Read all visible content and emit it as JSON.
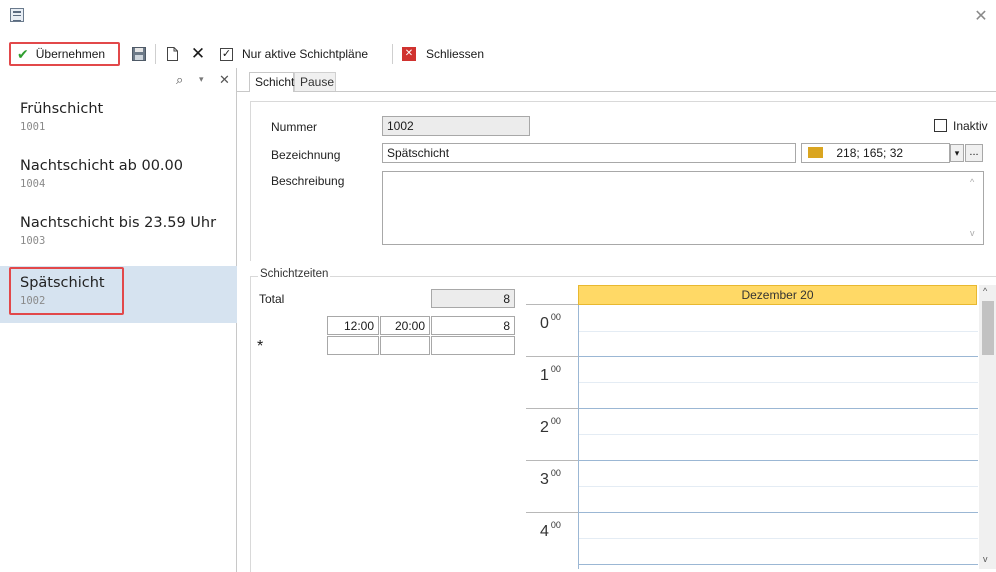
{
  "toolbar": {
    "apply_label": "Übernehmen",
    "active_plans_label": "Nur aktive Schichtpläne",
    "close_label": "Schliessen"
  },
  "list": {
    "items": [
      {
        "name": "Frühschicht",
        "code": "1001",
        "selected": false
      },
      {
        "name": "Nachtschicht ab 00.00",
        "code": "1004",
        "selected": false
      },
      {
        "name": "Nachtschicht bis 23.59 Uhr",
        "code": "1003",
        "selected": false
      },
      {
        "name": "Spätschicht",
        "code": "1002",
        "selected": true
      }
    ]
  },
  "tabs": [
    {
      "label": "Schicht",
      "active": true
    },
    {
      "label": "Pause",
      "active": false
    }
  ],
  "form": {
    "nummer_label": "Nummer",
    "nummer_value": "1002",
    "bezeichnung_label": "Bezeichnung",
    "bezeichnung_value": "Spätschicht",
    "beschreibung_label": "Beschreibung",
    "beschreibung_value": "",
    "inaktiv_label": "Inaktiv",
    "color_value": "218; 165; 32",
    "color_hex": "#daa520",
    "color_more": "..."
  },
  "schichtzeiten": {
    "group_label": "Schichtzeiten",
    "total_label": "Total",
    "total_value": "8",
    "rows": [
      {
        "start": "12:00",
        "end": "20:00",
        "hours": "8"
      }
    ],
    "new_row_marker": "*"
  },
  "calendar": {
    "header": "Dezember 20",
    "hours": [
      {
        "h": "0",
        "m": "00"
      },
      {
        "h": "1",
        "m": "00"
      },
      {
        "h": "2",
        "m": "00"
      },
      {
        "h": "3",
        "m": "00"
      },
      {
        "h": "4",
        "m": "00"
      }
    ]
  },
  "colors": {
    "highlight": "#e2484a",
    "selected_row": "#d6e3f0",
    "calendar_header": "#ffd966"
  }
}
